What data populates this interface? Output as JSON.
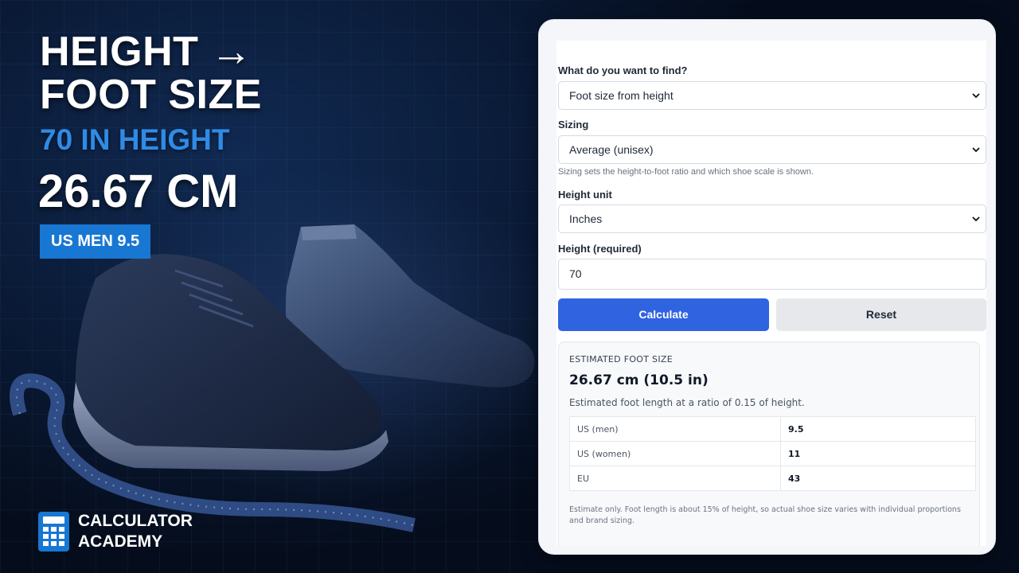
{
  "hero": {
    "title_line1": "HEIGHT →",
    "title_line2": "FOOT SIZE",
    "subtitle": "70 IN HEIGHT",
    "result": "26.67 CM",
    "badge": "US MEN 9.5"
  },
  "brand": {
    "line1": "CALCULATOR",
    "line2": "ACADEMY",
    "icon": "calculator-icon",
    "color": "#1877d2"
  },
  "form": {
    "find_label": "What do you want to find?",
    "find_value": "Foot size from height",
    "sizing_label": "Sizing",
    "sizing_value": "Average (unisex)",
    "sizing_hint": "Sizing sets the height-to-foot ratio and which shoe scale is shown.",
    "unit_label": "Height unit",
    "unit_value": "Inches",
    "height_label": "Height (required)",
    "height_value": "70",
    "calculate_label": "Calculate",
    "reset_label": "Reset"
  },
  "result": {
    "title": "ESTIMATED FOOT SIZE",
    "value": "26.67 cm (10.5 in)",
    "description": "Estimated foot length at a ratio of 0.15 of height.",
    "rows": [
      {
        "label": "US (men)",
        "value": "9.5"
      },
      {
        "label": "US (women)",
        "value": "11"
      },
      {
        "label": "EU",
        "value": "43"
      }
    ],
    "note": "Estimate only. Foot length is about 15% of height, so actual shoe size varies with individual proportions and brand sizing."
  },
  "colors": {
    "accent": "#2f63e0",
    "subtitle": "#2f8be6",
    "badge": "#1877d2"
  }
}
